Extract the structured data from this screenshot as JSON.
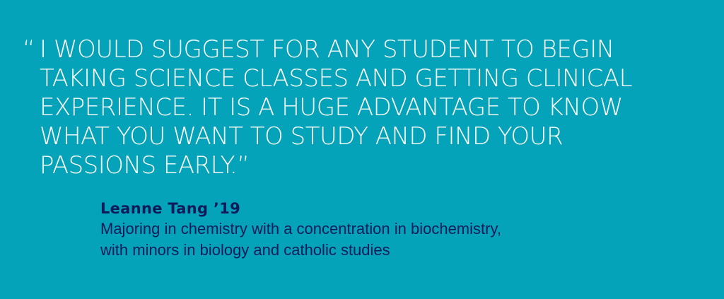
{
  "quote": {
    "open_mark": "“",
    "lines": [
      "I WOULD SUGGEST FOR ANY STUDENT TO BEGIN",
      "TAKING SCIENCE CLASSES AND GETTING CLINICAL",
      "EXPERIENCE. IT IS A HUGE ADVANTAGE TO KNOW",
      "WHAT YOU WANT TO STUDY AND FIND YOUR",
      "PASSIONS EARLY.”"
    ]
  },
  "attribution": {
    "name": "Leanne Tang ’19",
    "detail_lines": [
      "Majoring in chemistry with a concentration in biochemistry,",
      "with minors in biology and catholic studies"
    ]
  },
  "colors": {
    "background": "#04A3B9",
    "quote_text": "#FFFFFF",
    "attribution_text": "#0E1B5A"
  }
}
